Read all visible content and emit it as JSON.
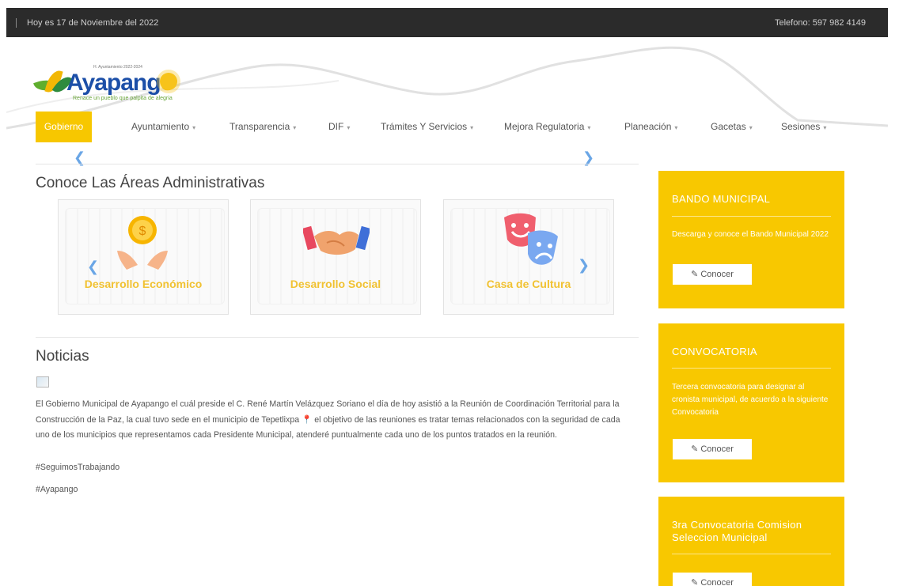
{
  "topbar": {
    "date": "Hoy es 17 de Noviembre del 2022",
    "phone": "Telefono: 597 982 4149"
  },
  "logo": {
    "name": "Ayapango",
    "name_a": "Ayapang",
    "name_o": "o",
    "tagline": "Renace un pueblo que palpita de alegria",
    "administration": "H. Ayuntamiento 2022-2024"
  },
  "nav": {
    "items": [
      {
        "label": "Gobierno",
        "caret": ""
      },
      {
        "label": "Ayuntamiento",
        "caret": "▾"
      },
      {
        "label": "Transparencia",
        "caret": "▾"
      },
      {
        "label": "DIF",
        "caret": "▾"
      },
      {
        "label": "Trámites Y Servicios",
        "caret": "▾"
      },
      {
        "label": "Mejora Regulatoria",
        "caret": "▾"
      },
      {
        "label": "Planeación",
        "caret": "▾"
      },
      {
        "label": "Gacetas",
        "caret": "▾"
      },
      {
        "label": "Sesiones",
        "caret": "▾"
      }
    ]
  },
  "areas": {
    "title": "Conoce Las Áreas Administrativas",
    "cards": [
      {
        "label": "Desarrollo Económico",
        "icon": "money-hands-icon"
      },
      {
        "label": "Desarrollo Social",
        "icon": "handshake-icon"
      },
      {
        "label": "Casa de Cultura",
        "icon": "theater-masks-icon"
      }
    ]
  },
  "news": {
    "title": "Noticias",
    "body": "El Gobierno Municipal de Ayapango el cuál preside el C. René Martín Velázquez Soriano el día de hoy asistió a la Reunión de Coordinación Territorial para la Construcción de la Paz, la cual tuvo sede en el municipio de Tepetlixpa 📍 el objetivo de las reuniones es tratar temas relacionados con la seguridad de cada uno de los municipios que representamos cada Presidente Municipal, atenderé puntualmente cada uno de los puntos tratados en la reunión.",
    "hashtag1": "#SeguimosTrabajando",
    "hashtag2": "#Ayapango"
  },
  "sidebar": {
    "boxes": [
      {
        "title": "BANDO MUNICIPAL",
        "text": "Descarga y conoce el Bando Municipal 2022",
        "button": "✎ Conocer"
      },
      {
        "title": "CONVOCATORIA",
        "text": "Tercera convocatoria para designar al cronista municipal, de acuerdo a la siguiente Convocatoria",
        "button": "✎ Conocer"
      },
      {
        "title": "3ra Convocatoria Comision Seleccion Municipal",
        "text": "",
        "button": "✎ Conocer"
      }
    ]
  },
  "colors": {
    "accent": "#f8c800",
    "topbar": "#2b2b2b",
    "arrow": "#6aa6e6",
    "card_label": "#f1c232"
  }
}
